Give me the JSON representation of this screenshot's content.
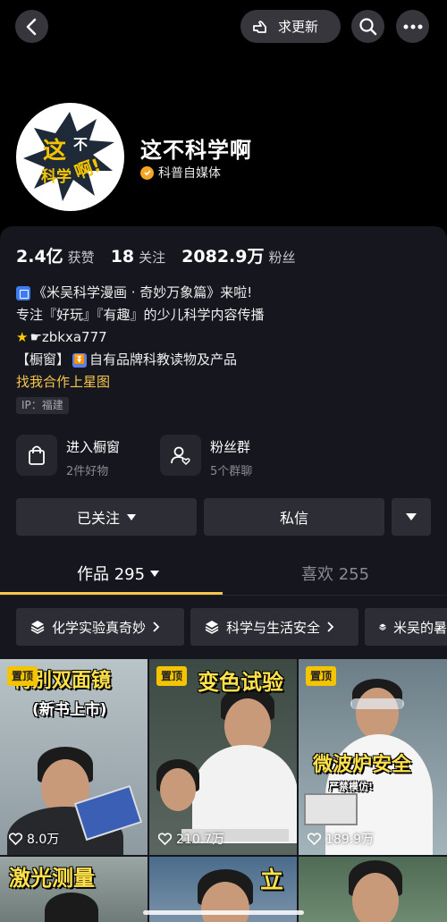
{
  "topbar": {
    "request_update_label": "求更新"
  },
  "profile": {
    "name": "这不科学啊",
    "verification": "科普自媒体",
    "avatar_text_a": "这",
    "avatar_text_b": "不",
    "avatar_text_c": "科学",
    "avatar_text_d": "啊!"
  },
  "stats": [
    {
      "value": "2.4亿",
      "label": "获赞"
    },
    {
      "value": "18",
      "label": "关注"
    },
    {
      "value": "2082.9万",
      "label": "粉丝"
    }
  ],
  "bio": {
    "line1": "《米吴科学漫画 · 奇妙万象篇》来啦!",
    "line2": "专注『好玩』『有趣』的少儿科学内容传播",
    "line3": "☛zbkxa777",
    "line4_prefix": "【橱窗】",
    "line4_text": "自有品牌科教读物及产品",
    "line5": "找我合作上星图",
    "ip": "IP：福建"
  },
  "features": [
    {
      "title": "进入橱窗",
      "sub": "2件好物",
      "icon": "shopping-bag-icon"
    },
    {
      "title": "粉丝群",
      "sub": "5个群聊",
      "icon": "fan-group-icon"
    }
  ],
  "actions": {
    "followed_label": "已关注",
    "message_label": "私信"
  },
  "tabs": {
    "works_label": "作品 295",
    "likes_label": "喜欢 255"
  },
  "chips": [
    "化学实验真奇妙",
    "科学与生活安全",
    "米吴的暑"
  ],
  "videos": [
    {
      "pinned": "置顶",
      "likes": "8.0万",
      "caption": "特别双面镜",
      "caption2": "(新书上市)"
    },
    {
      "pinned": "置顶",
      "likes": "210.7万",
      "caption": "变色试验"
    },
    {
      "pinned": "置顶",
      "likes": "189.9万",
      "caption": "微波炉安全",
      "caption2": "严禁模仿!"
    },
    {
      "caption": "激光测量"
    },
    {
      "caption": "立"
    },
    {
      "caption": ""
    }
  ],
  "colors": {
    "accent": "#f5c64a",
    "card_bg": "#15161e",
    "button_bg": "#2c2d35",
    "pin_bg": "#f5c400"
  }
}
